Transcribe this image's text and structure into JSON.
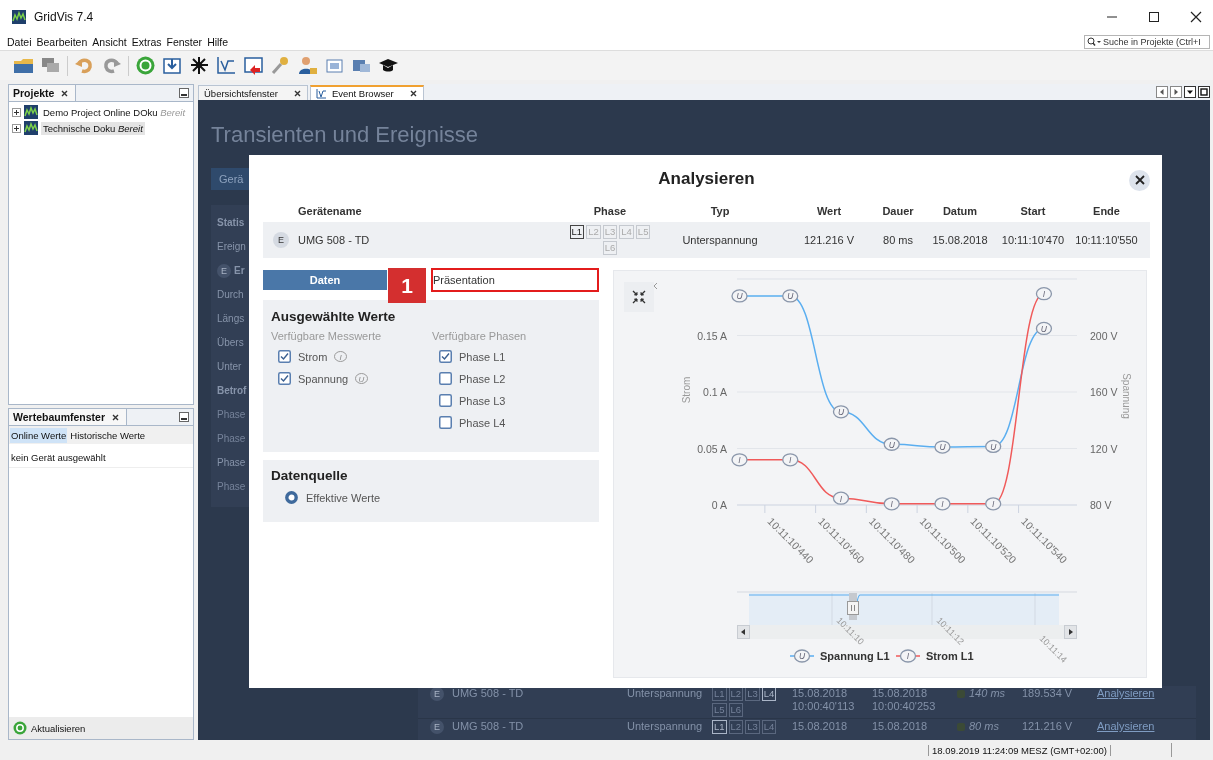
{
  "window": {
    "title": "GridVis 7.4"
  },
  "menu": [
    "Datei",
    "Bearbeiten",
    "Ansicht",
    "Extras",
    "Fenster",
    "Hilfe"
  ],
  "search": {
    "placeholder": "Suche in Projekte (Ctrl+I"
  },
  "projects_panel": {
    "title": "Projekte",
    "items": [
      {
        "label": "Demo Project Online DOku",
        "status": "Bereit",
        "selected": false
      },
      {
        "label": "Technische Doku",
        "status": "Bereit",
        "selected": true
      }
    ]
  },
  "values_panel": {
    "title": "Wertebaumfenster",
    "tabs": [
      {
        "label": "Online Werte",
        "selected": true
      },
      {
        "label": "Historische Werte",
        "selected": false
      }
    ],
    "message": "kein Gerät ausgewählt",
    "refresh_button": "Aktualisieren"
  },
  "editor_tabs": [
    {
      "label": "Übersichtsfenster",
      "selected": false
    },
    {
      "label": "Event Browser",
      "selected": true
    }
  ],
  "page": {
    "title": "Transienten und Ereignisse",
    "button": "Gerä",
    "summary": [
      {
        "kind": "heading",
        "text": "Statis"
      },
      {
        "kind": "line",
        "text": "Ereign"
      },
      {
        "kind": "badge",
        "badge": "E",
        "text": "Er"
      },
      {
        "kind": "line",
        "text": "Durch"
      },
      {
        "kind": "line",
        "text": "Längs"
      },
      {
        "kind": "line",
        "text": "Übers"
      },
      {
        "kind": "line",
        "text": "Unter"
      },
      {
        "kind": "heading",
        "text": "Betrof"
      },
      {
        "kind": "faint",
        "text": "Phase"
      },
      {
        "kind": "faint",
        "text": "Phase"
      },
      {
        "kind": "line",
        "text": "Phase"
      },
      {
        "kind": "faint",
        "text": "Phase"
      }
    ],
    "rows": [
      {
        "badge": "E",
        "device": "UMG 508 - TD",
        "type": "Unterspannung",
        "phases": [
          {
            "label": "L1",
            "active": false
          },
          {
            "label": "L2",
            "active": false
          },
          {
            "label": "L3",
            "active": false
          },
          {
            "label": "L4",
            "active": true
          },
          {
            "label": "L5",
            "active": false
          },
          {
            "label": "L6",
            "active": false
          }
        ],
        "start": [
          "15.08.2018",
          "10:00:40'113"
        ],
        "end": [
          "15.08.2018",
          "10:00:40'253"
        ],
        "duration": "140 ms",
        "value": "189.534 V",
        "action": "Analysieren"
      },
      {
        "badge": "E",
        "device": "UMG 508 - TD",
        "type": "Unterspannung",
        "phases": [
          {
            "label": "L1",
            "active": true
          },
          {
            "label": "L2",
            "active": false
          },
          {
            "label": "L3",
            "active": false
          },
          {
            "label": "L4",
            "active": false
          }
        ],
        "start": [
          "15.08.2018"
        ],
        "end": [
          "15.08.2018"
        ],
        "duration": "80 ms",
        "value": "121.216 V",
        "action": "Analysieren"
      }
    ]
  },
  "modal": {
    "title": "Analysieren",
    "columns": [
      "Gerätename",
      "Phase",
      "Typ",
      "Wert",
      "Dauer",
      "Datum",
      "Start",
      "Ende"
    ],
    "row": {
      "badge": "E",
      "device": "UMG 508 - TD",
      "phases": [
        {
          "label": "L1",
          "active": true
        },
        {
          "label": "L2",
          "active": false
        },
        {
          "label": "L3",
          "active": false
        },
        {
          "label": "L4",
          "active": false
        },
        {
          "label": "L5",
          "active": false
        },
        {
          "label": "L6",
          "active": false
        }
      ],
      "type": "Unterspannung",
      "value": "121.216 V",
      "duration": "80 ms",
      "date": "15.08.2018",
      "start": "10:11:10'470",
      "end": "10:11:10'550"
    },
    "tabs": [
      {
        "label": "Daten",
        "selected": true,
        "highlighted": false
      },
      {
        "label": "Präsentation",
        "selected": false,
        "highlighted": true
      }
    ],
    "step_badge": "1",
    "selection": {
      "title": "Ausgewählte Werte",
      "measures_label": "Verfügbare Messwerte",
      "measures": [
        {
          "label": "Strom",
          "symbol": "I",
          "checked": true
        },
        {
          "label": "Spannung",
          "symbol": "U",
          "checked": true
        }
      ],
      "phases_label": "Verfügbare Phasen",
      "phases": [
        {
          "label": "Phase L1",
          "checked": true
        },
        {
          "label": "Phase L2",
          "checked": false
        },
        {
          "label": "Phase L3",
          "checked": false
        },
        {
          "label": "Phase L4",
          "checked": false
        }
      ]
    },
    "source": {
      "title": "Datenquelle",
      "options": [
        {
          "label": "Effektive Werte",
          "selected": true
        }
      ]
    },
    "chart": {
      "chart_data": {
        "type": "line",
        "ylabel": "Strom",
        "y2label": "Spannung",
        "categories": [
          null,
          "10:11:10'440",
          null,
          "10:11:10'460",
          null,
          "10:11:10'480",
          null,
          "10:11:10'500",
          null,
          "10:11:10'520",
          null,
          "10:11:10'540",
          null
        ],
        "ylim": [
          0,
          0.2
        ],
        "y2lim": [
          80,
          240
        ],
        "grid": true,
        "legend": true,
        "yticks": [
          {
            "value": 0,
            "label": "0 A"
          },
          {
            "value": 0.05,
            "label": "0.05 A"
          },
          {
            "value": 0.1,
            "label": "0.1 A"
          },
          {
            "value": 0.15,
            "label": "0.15 A"
          }
        ],
        "y2ticks": [
          {
            "value": 80,
            "label": "80 V"
          },
          {
            "value": 120,
            "label": "120 V"
          },
          {
            "value": 160,
            "label": "160 V"
          },
          {
            "value": 200,
            "label": "200 V"
          }
        ],
        "series": [
          {
            "name": "Spannung L1",
            "color": "#5aaef0",
            "axis": "y2",
            "marker": "circle",
            "values": [
              228,
              null,
              228,
              null,
              146,
              null,
              123,
              null,
              121,
              null,
              121.5,
              null,
              205
            ]
          },
          {
            "name": "Strom L1",
            "color": "#f05a5a",
            "marker": "circle",
            "values": [
              0.04,
              null,
              0.04,
              null,
              0.006,
              null,
              0.001,
              null,
              0.001,
              null,
              0.001,
              null,
              0.187
            ]
          }
        ]
      },
      "point_symbols": [
        [
          "U",
          "U",
          "U",
          "U",
          "U",
          "U",
          "U"
        ],
        [
          "I",
          "I",
          "I",
          "I",
          "I",
          "I",
          "I"
        ]
      ],
      "legend_symbols": [
        "U",
        "I"
      ],
      "navigator": {
        "labels": [
          "10:11:10",
          "10:11:12",
          "10:11:14"
        ]
      }
    }
  },
  "status_bar": {
    "datetime": "18.09.2019 11:24:09 MESZ (GMT+02:00)"
  }
}
